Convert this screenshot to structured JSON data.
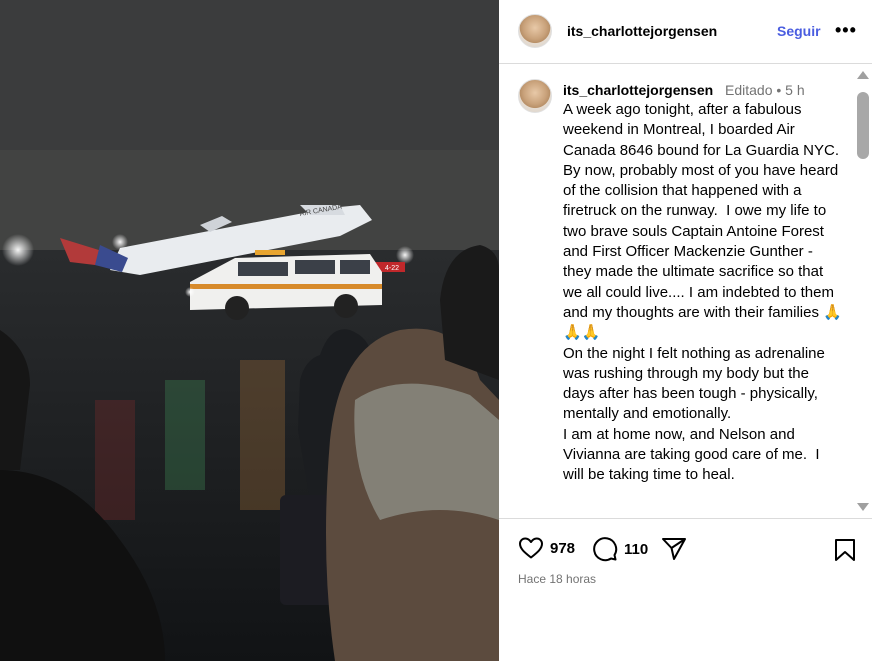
{
  "post": {
    "username": "its_charlottejorgensen",
    "follow_label": "Seguir",
    "more_label": "•••",
    "edited_label": "Editado •  5 h",
    "caption": "A week ago tonight, after a fabulous weekend in Montreal, I boarded Air Canada 8646 bound for La Guardia NYC.  By now, probably most of you have heard of the collision that happened with a firetruck on the runway.  I owe my life to two brave souls Captain Antoine Forest and First Officer Mackenzie Gunther - they made the ultimate sacrifice so that we all could live.... I am indebted to them and my thoughts are with their families 🙏🙏🙏\nOn the night I felt nothing as adrenaline was rushing through my body but the days after has been tough - physically, mentally and emotionally.\nI am at home now, and Nelson and Vivianna are taking good care of me.  I will be taking time to heal.",
    "likes": "978",
    "comments": "110",
    "time_ago": "Hace 18 horas"
  },
  "photo": {
    "plane_lettering": "AIR CANADA",
    "sign_text": "4-22"
  },
  "icons": {
    "like": "heart-icon",
    "comment": "comment-bubble-icon",
    "share": "paper-plane-icon",
    "save": "bookmark-icon",
    "more": "ellipsis-icon"
  },
  "colors": {
    "follow": "#4a5de0",
    "muted": "#737373",
    "divider": "#dbdbdb"
  }
}
